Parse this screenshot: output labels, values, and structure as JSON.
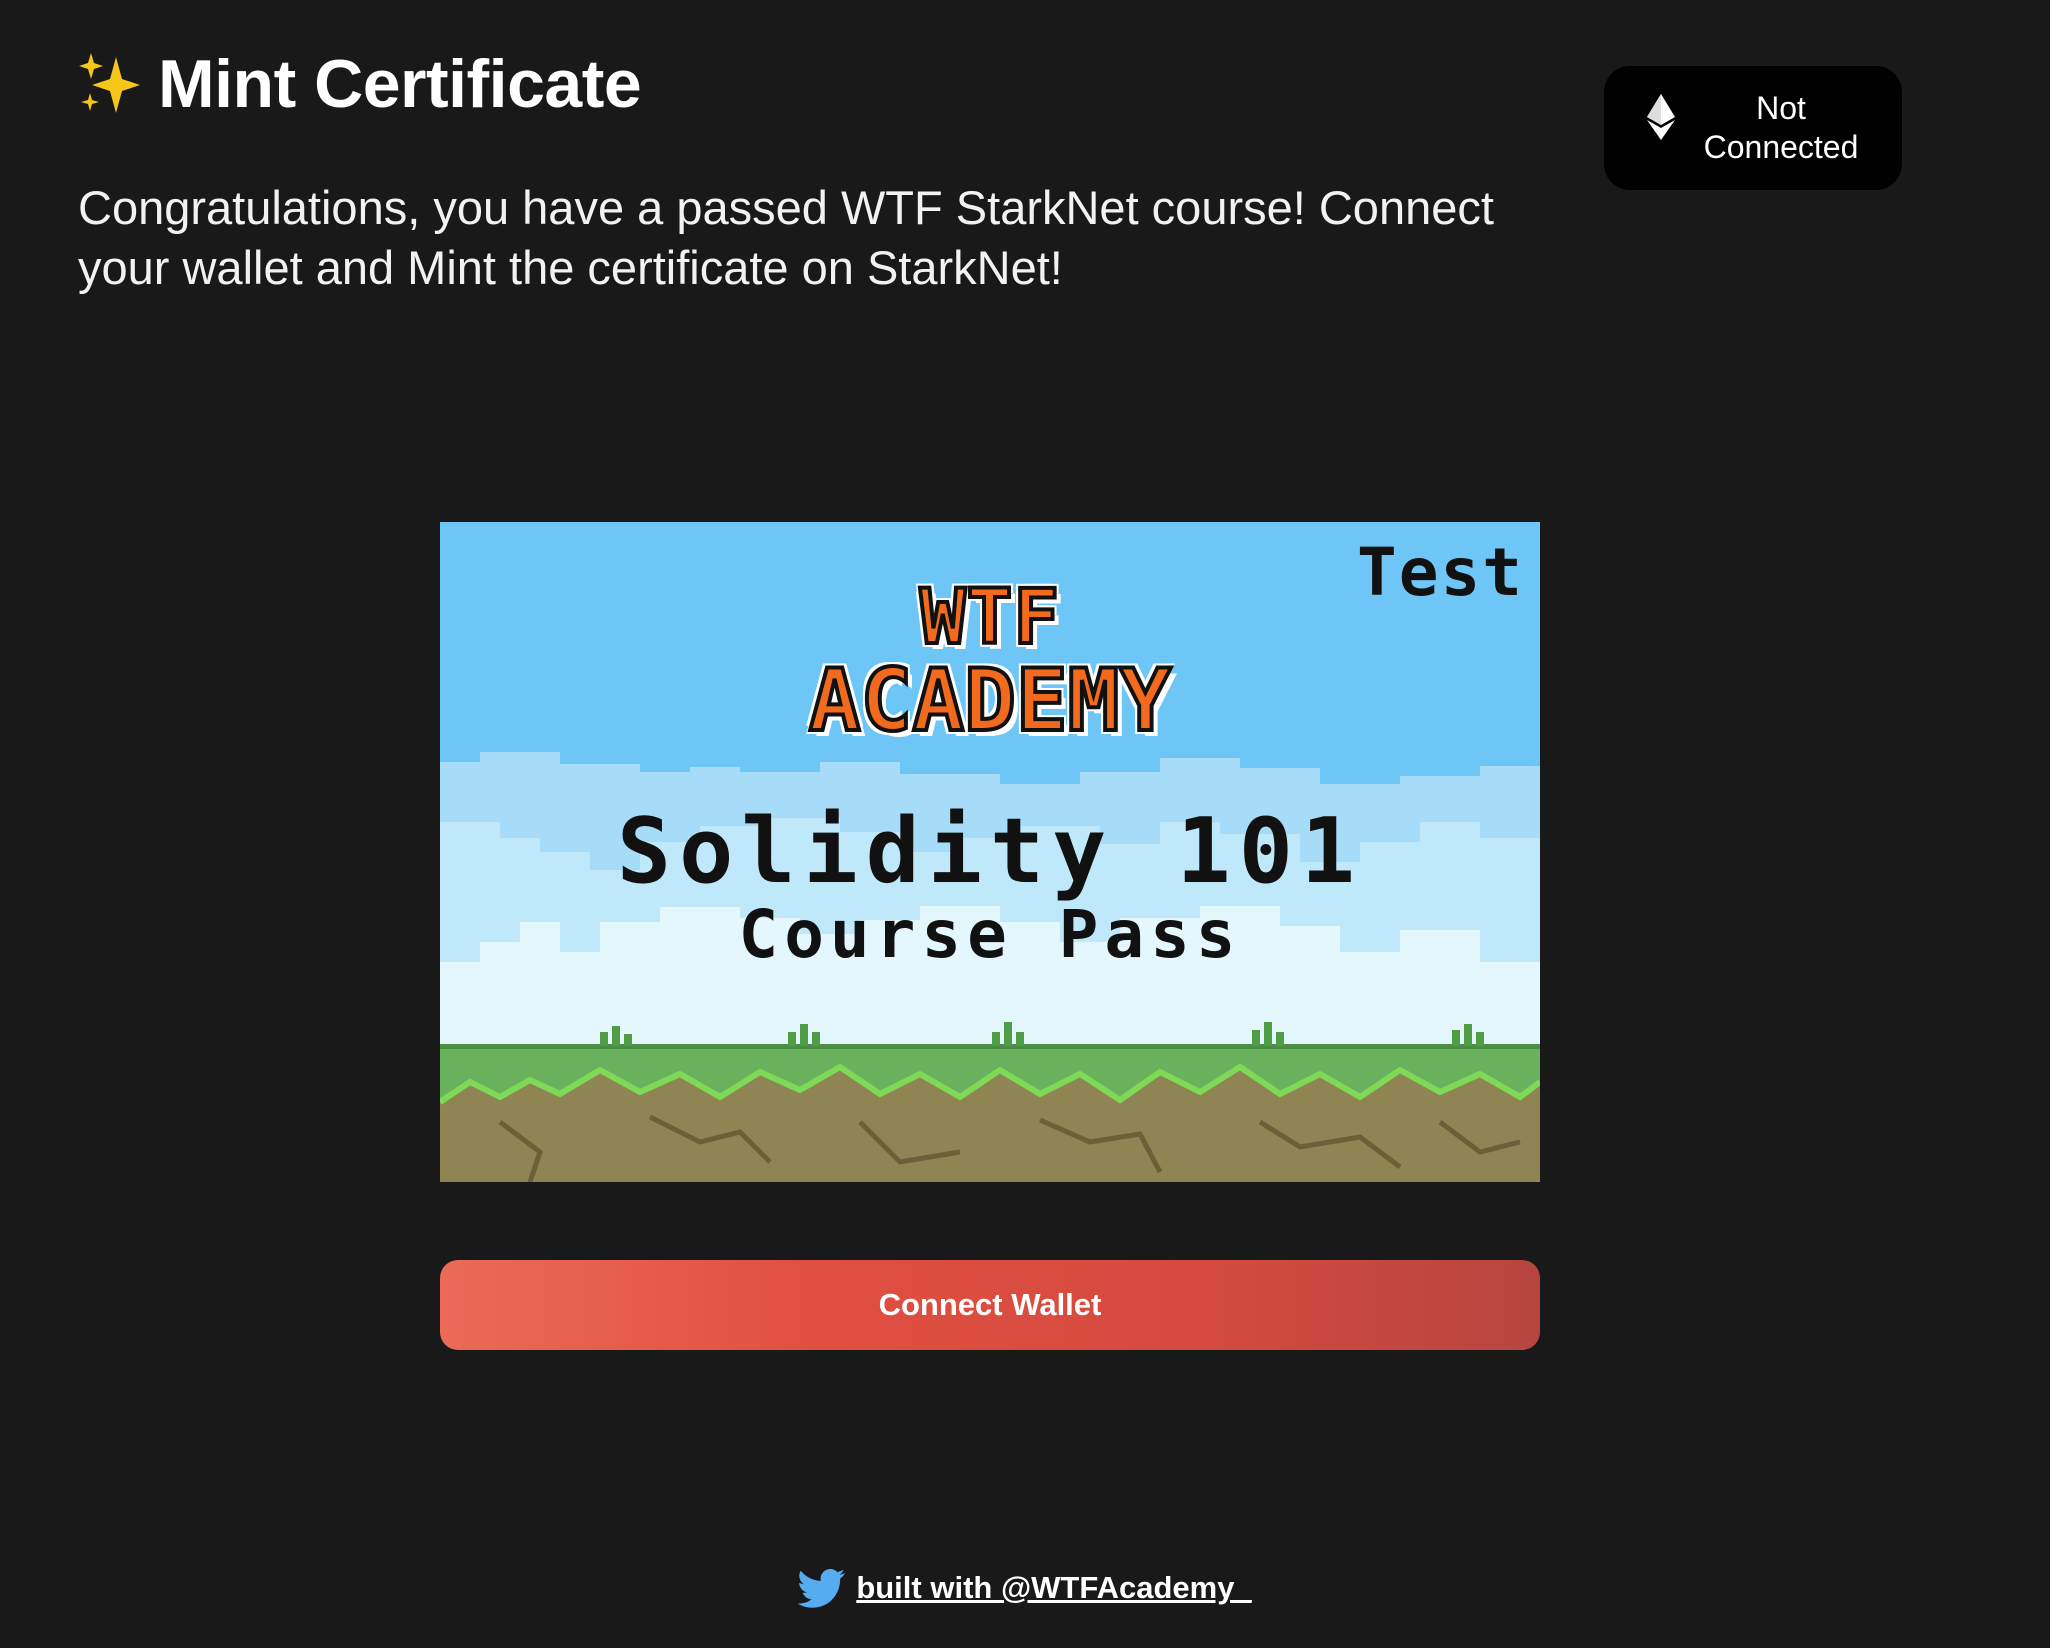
{
  "header": {
    "title": "Mint Certificate",
    "title_icon": "sparkles-icon",
    "subtitle": "Congratulations, you have a passed WTF StarkNet course! Connect your wallet and Mint the certificate on StarkNet!"
  },
  "wallet": {
    "icon": "ethereum-icon",
    "status_label": "Not Connected"
  },
  "certificate": {
    "badge": "Test",
    "logo_line1": "WTF",
    "logo_line2": "ACADEMY",
    "course_title": "Solidity 101",
    "course_subtitle": "Course Pass"
  },
  "actions": {
    "connect_label": "Connect Wallet"
  },
  "footer": {
    "icon": "twitter-icon",
    "link_text": "built with @WTFAcademy_"
  },
  "colors": {
    "background": "#191919",
    "button_gradient_start": "#eb6a58",
    "button_gradient_end": "#b6453f",
    "twitter_blue": "#55acee"
  }
}
